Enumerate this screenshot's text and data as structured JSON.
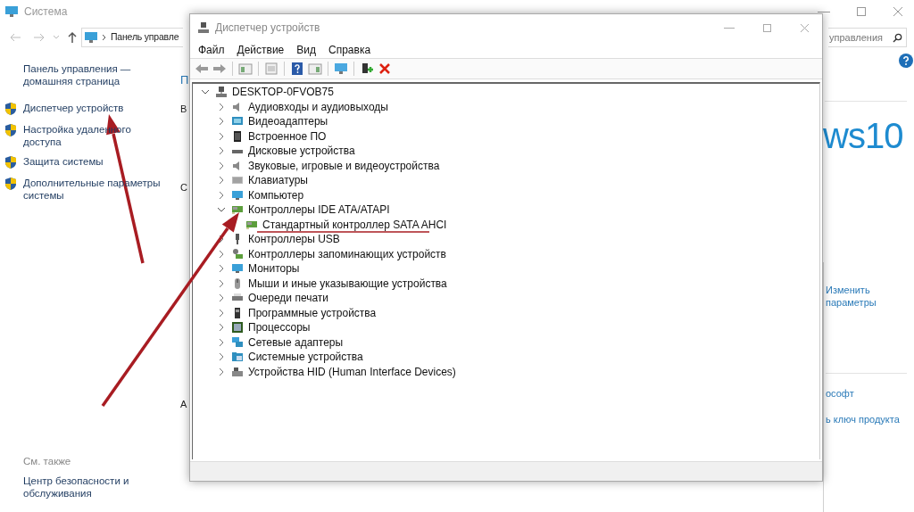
{
  "system_window": {
    "title": "Система",
    "address": "Панель управле",
    "search": {
      "placeholder": "управления"
    },
    "sidebar": {
      "home_link": "Панель управления — домашняя страница",
      "tasks": [
        "Диспетчер устройств",
        "Настройка удаленного доступа",
        "Защита системы",
        "Дополнительные параметры системы"
      ],
      "see_also_heading": "См. также",
      "see_also": [
        "Центр безопасности и обслуживания"
      ]
    },
    "partial_texts": [
      "П",
      "В",
      "С",
      "А"
    ],
    "logo_text": "ws10",
    "right_links": [
      "Изменить параметры",
      "ософт",
      "ь ключ продукта"
    ]
  },
  "device_manager": {
    "title": "Диспетчер устройств",
    "menu": [
      "Файл",
      "Действие",
      "Вид",
      "Справка"
    ],
    "tree": {
      "label": "DESKTOP-0FVOB75",
      "expanded": true,
      "children": [
        {
          "label": "Аудиовходы и аудиовыходы",
          "expanded": false
        },
        {
          "label": "Видеоадаптеры",
          "expanded": false
        },
        {
          "label": "Встроенное ПО",
          "expanded": false
        },
        {
          "label": "Дисковые устройства",
          "expanded": false
        },
        {
          "label": "Звуковые, игровые и видеоустройства",
          "expanded": false
        },
        {
          "label": "Клавиатуры",
          "expanded": false
        },
        {
          "label": "Компьютер",
          "expanded": false
        },
        {
          "label": "Контроллеры IDE ATA/ATAPI",
          "expanded": true,
          "children": [
            {
              "label": "Стандартный контроллер SATA AHCI"
            }
          ]
        },
        {
          "label": "Контроллеры USB",
          "expanded": false
        },
        {
          "label": "Контроллеры запоминающих устройств",
          "expanded": false
        },
        {
          "label": "Мониторы",
          "expanded": false
        },
        {
          "label": "Мыши и иные указывающие устройства",
          "expanded": false
        },
        {
          "label": "Очереди печати",
          "expanded": false
        },
        {
          "label": "Программные устройства",
          "expanded": false
        },
        {
          "label": "Процессоры",
          "expanded": false
        },
        {
          "label": "Сетевые адаптеры",
          "expanded": false
        },
        {
          "label": "Системные устройства",
          "expanded": false
        },
        {
          "label": "Устройства HID (Human Interface Devices)",
          "expanded": false
        }
      ]
    }
  }
}
